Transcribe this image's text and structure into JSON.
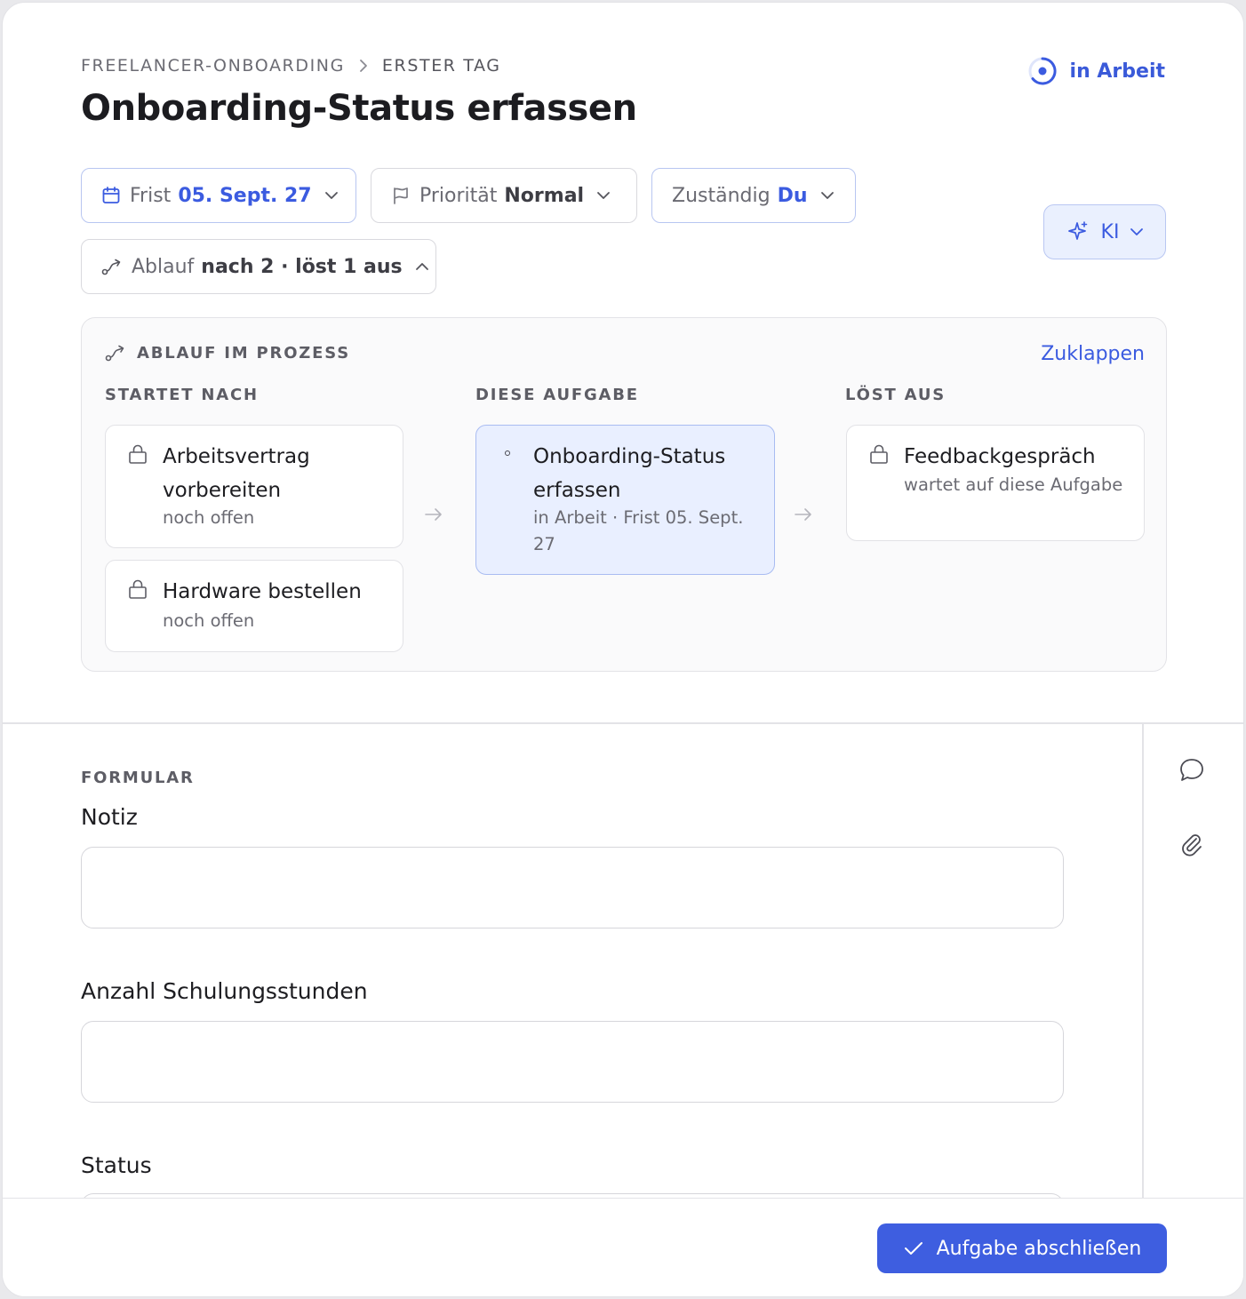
{
  "breadcrumb": {
    "parent": "FREELANCER-ONBOARDING",
    "current": "ERSTER TAG"
  },
  "task": {
    "title": "Onboarding-Status erfassen",
    "status": "in Arbeit"
  },
  "chips": {
    "deadline": {
      "label": "Frist",
      "value": "05. Sept. 27"
    },
    "priority": {
      "label": "Priorität",
      "value": "Normal"
    },
    "assignee": {
      "label": "Zuständig",
      "value": "Du"
    },
    "flow": {
      "label": "Ablauf",
      "value": "nach 2 · löst 1 aus"
    }
  },
  "ai": {
    "label": "KI"
  },
  "process": {
    "heading": "ABLAUF IM PROZESS",
    "collapse_label": "Zuklappen",
    "columns": {
      "before": "STARTET NACH",
      "this": "DIESE AUFGABE",
      "after": "LÖST AUS"
    },
    "before": [
      {
        "title": "Arbeitsvertrag vorbereiten",
        "sub": "noch offen"
      },
      {
        "title": "Hardware bestellen",
        "sub": "noch offen"
      }
    ],
    "current": {
      "title": "Onboarding-Status erfassen",
      "sub": "in Arbeit · Frist 05. Sept. 27"
    },
    "after": [
      {
        "title": "Feedbackgespräch",
        "sub": "wartet auf diese Aufgabe"
      }
    ]
  },
  "form": {
    "section_label": "FORMULAR",
    "fields": [
      {
        "label": "Notiz",
        "value": ""
      },
      {
        "label": "Anzahl Schulungsstunden",
        "value": ""
      },
      {
        "label": "Status"
      }
    ]
  },
  "footer": {
    "complete_label": "Aufgabe abschließen"
  },
  "colors": {
    "accent": "#3e5ee0",
    "accent_text": "#3b5be0",
    "current_bg": "#e9efff"
  }
}
